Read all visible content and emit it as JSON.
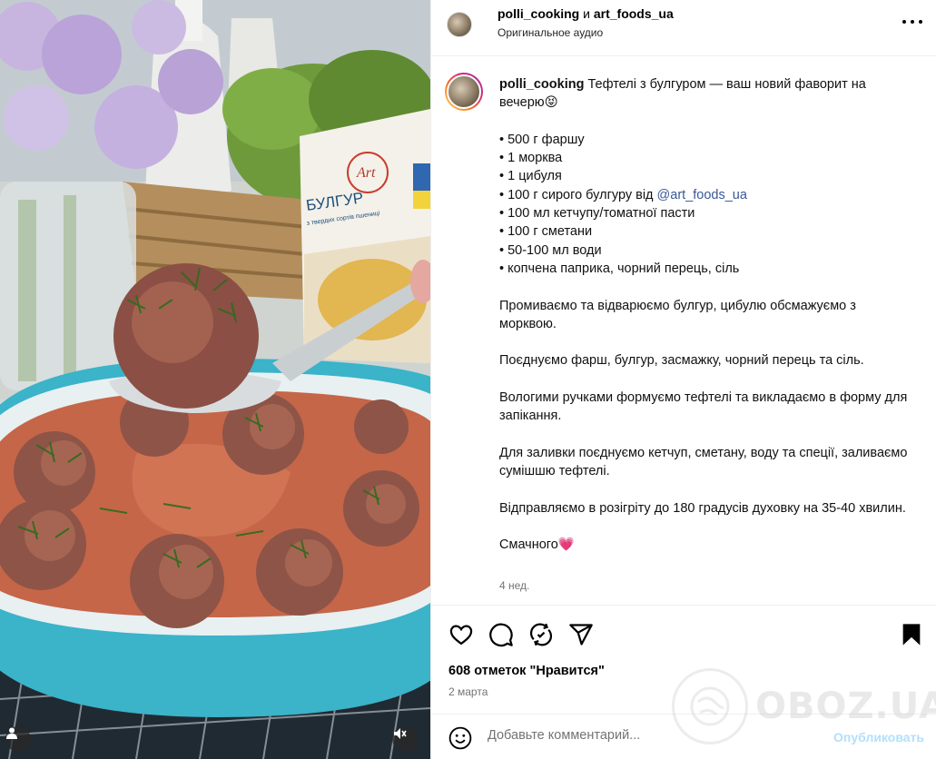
{
  "header": {
    "username_primary": "polli_cooking",
    "conjunction": "и",
    "username_collab": "art_foods_ua",
    "audio_label": "Оригинальное аудио",
    "more_icon": "more-horizontal-icon"
  },
  "caption": {
    "username": "polli_cooking",
    "title": "Тефтелі з булгуром — ваш новий фаворит на вечерю😝",
    "ingredients": [
      "• 500 г фаршу",
      "• 1 морква",
      "• 1 цибуля"
    ],
    "ingredient_bulgur_prefix": "• 100 г сирого булгуру від ",
    "ingredient_bulgur_mention": "@art_foods_ua",
    "ingredients_rest": [
      "• 100 мл кетчупу/томатної пасти",
      "• 100 г сметани",
      "• 50-100 мл води",
      "• копчена паприка, чорний перець, сіль"
    ],
    "steps": [
      "Промиваємо та відварюємо булгур, цибулю обсмажуємо з морквою.",
      "Поєднуємо фарш, булгур, засмажку, чорний перець та сіль.",
      "Вологими ручками формуємо тефтелі та викладаємо в форму для запікання.",
      "Для заливки поєднуємо кетчуп, сметану, воду та спеції, заливаємо сумішшю тефтелі.",
      "Відправляємо в розігріту до 180 градусів духовку на 35-40 хвилин."
    ],
    "closing": "Смачного💗",
    "time_ago": "4 нед."
  },
  "actions": {
    "icons": [
      "heart-icon",
      "comment-icon",
      "repost-icon",
      "share-icon",
      "bookmark-icon"
    ],
    "likes_text": "608 отметок \"Нравится\"",
    "date": "2 марта"
  },
  "comment": {
    "placeholder": "Добавьте комментарий...",
    "post_label": "Опубликовать"
  },
  "media": {
    "package_brand": "Art",
    "package_title": "БУЛГУР",
    "package_subtitle": "з твердих сортів пшениці"
  },
  "watermark": "OBOZ.UA",
  "colors": {
    "accent_link": "#385898",
    "post_button": "#b2dffc",
    "secondary_text": "#737373",
    "dish_blue": "#3bb3c9"
  }
}
